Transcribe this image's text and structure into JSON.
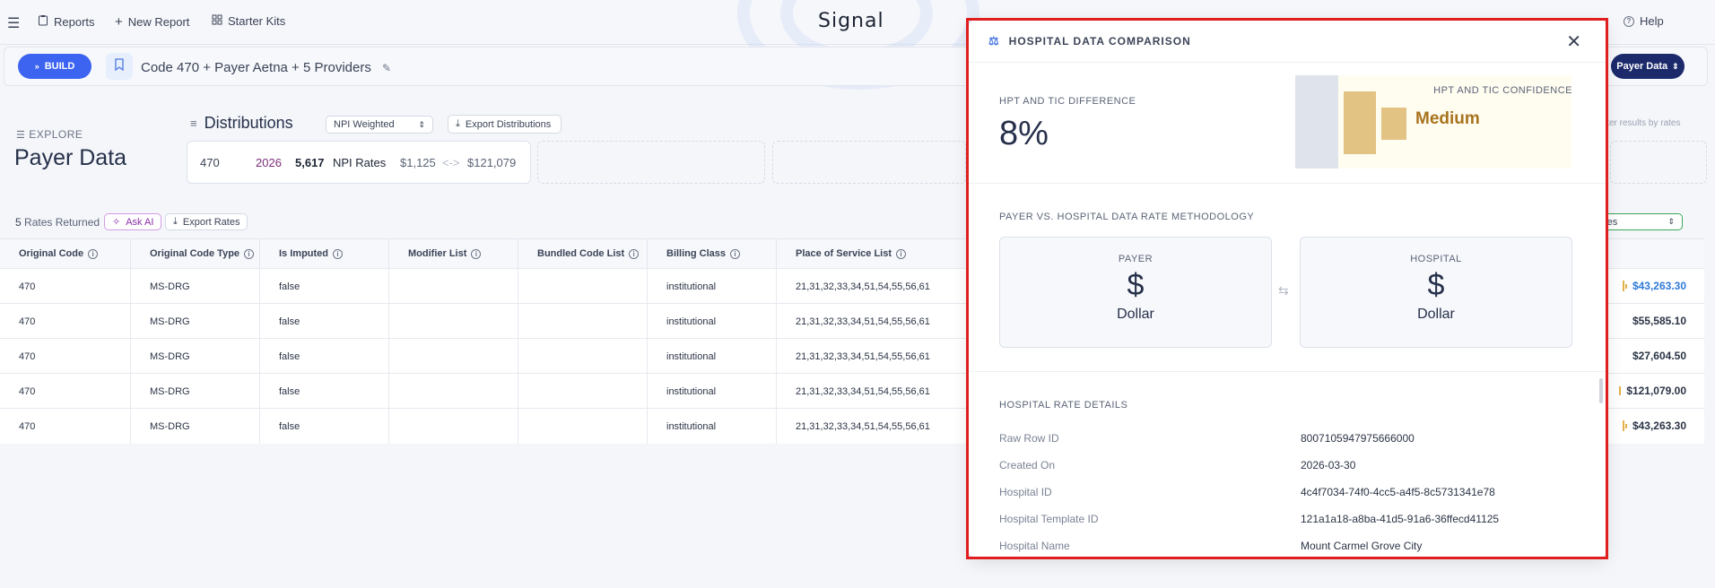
{
  "topbar": {
    "reports": "Reports",
    "new_report": "New Report",
    "starter_kits": "Starter Kits",
    "logo": "Signal",
    "help": "Help"
  },
  "buildbar": {
    "build_label": "BUILD",
    "report_title": "Code 470 + Payer Aetna + 5 Providers",
    "payer_data_label": "Payer Data"
  },
  "explore": {
    "eyebrow": "EXPLORE",
    "title": "Payer Data",
    "filter_hint": "filter results by rates"
  },
  "distributions": {
    "title": "Distributions",
    "weight_select": "NPI Weighted",
    "export_label": "Export Distributions",
    "card": {
      "code": "470",
      "year": "2026",
      "count": "5,617",
      "count_label": "NPI Rates",
      "min": "$1,125",
      "max": "$121,079"
    }
  },
  "results": {
    "count": "5",
    "count_label": "Rates Returned",
    "ask_ai": "Ask AI",
    "export_rates": "Export Rates",
    "baselines_select": "selines"
  },
  "table": {
    "columns": [
      "Original Code",
      "Original Code Type",
      "Is Imputed",
      "Modifier List",
      "Bundled Code List",
      "Billing Class",
      "Place of Service List"
    ],
    "rows": [
      {
        "code": "470",
        "type": "MS-DRG",
        "imputed": "false",
        "modifier": "",
        "bundled": "",
        "billing": "institutional",
        "pos": "21,31,32,33,34,51,54,55,56,61",
        "amount": "$43,263.30",
        "amount_color": "#2f7ad8"
      },
      {
        "code": "470",
        "type": "MS-DRG",
        "imputed": "false",
        "modifier": "",
        "bundled": "",
        "billing": "institutional",
        "pos": "21,31,32,33,34,51,54,55,56,61",
        "amount": "$55,585.10",
        "amount_color": "#1c2433"
      },
      {
        "code": "470",
        "type": "MS-DRG",
        "imputed": "false",
        "modifier": "",
        "bundled": "",
        "billing": "institutional",
        "pos": "21,31,32,33,34,51,54,55,56,61",
        "amount": "$27,604.50",
        "amount_color": "#1c2433"
      },
      {
        "code": "470",
        "type": "MS-DRG",
        "imputed": "false",
        "modifier": "",
        "bundled": "",
        "billing": "institutional",
        "pos": "21,31,32,33,34,51,54,55,56,61",
        "amount": "$121,079.00",
        "amount_color": "#1c2433"
      },
      {
        "code": "470",
        "type": "MS-DRG",
        "imputed": "false",
        "modifier": "",
        "bundled": "",
        "billing": "institutional",
        "pos": "21,31,32,33,34,51,54,55,56,61",
        "amount": "$43,263.30",
        "amount_color": "#1c2433"
      }
    ]
  },
  "modal": {
    "title": "HOSPITAL DATA COMPARISON",
    "difference_label": "HPT AND TIC DIFFERENCE",
    "difference_value": "8%",
    "confidence_label": "HPT AND TIC CONFIDENCE",
    "confidence_value": "Medium",
    "confidence_color": "#a8731e",
    "methodology_label": "PAYER VS. HOSPITAL DATA RATE METHODOLOGY",
    "payer": {
      "label": "PAYER",
      "symbol": "$",
      "name": "Dollar"
    },
    "hospital": {
      "label": "HOSPITAL",
      "symbol": "$",
      "name": "Dollar"
    },
    "details_label": "HOSPITAL RATE DETAILS",
    "details": [
      {
        "key": "Raw Row ID",
        "value": "8007105947975666000"
      },
      {
        "key": "Created On",
        "value": "2026-03-30"
      },
      {
        "key": "Hospital ID",
        "value": "4c4f7034-74f0-4cc5-a4f5-8c5731341e78"
      },
      {
        "key": "Hospital Template ID",
        "value": "121a1a18-a8ba-41d5-91a6-36ffecd41125"
      },
      {
        "key": "Hospital Name",
        "value": "Mount Carmel Grove City"
      }
    ]
  },
  "colors": {
    "accent": "#3c64f0",
    "navy": "#1c2a6b",
    "highlight_border": "#e01e1e"
  }
}
